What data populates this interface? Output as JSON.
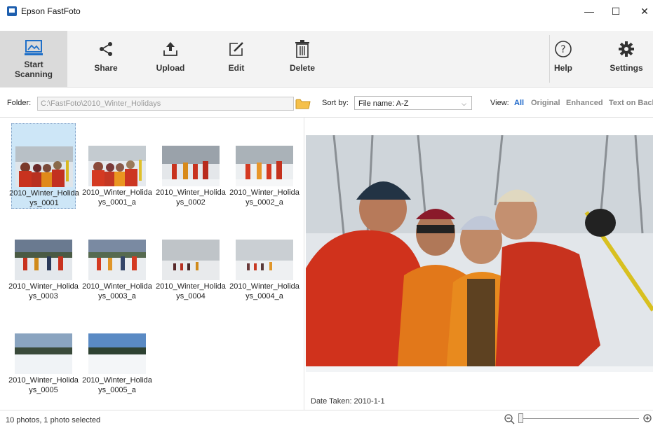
{
  "window": {
    "title": "Epson FastFoto",
    "minimize_glyph": "—",
    "maximize_glyph": "☐",
    "close_glyph": "✕"
  },
  "toolbar": {
    "start_scanning": "Start Scanning",
    "share": "Share",
    "upload": "Upload",
    "edit": "Edit",
    "delete": "Delete",
    "help": "Help",
    "settings": "Settings"
  },
  "filter": {
    "folder_label": "Folder:",
    "folder_value": "C:\\FastFoto\\2010_Winter_Holidays",
    "sort_label": "Sort by:",
    "sort_value": "File name: A-Z",
    "view_label": "View:",
    "view_options": [
      "All",
      "Original",
      "Enhanced",
      "Text on Back"
    ],
    "view_selected": "All"
  },
  "photos": [
    {
      "name": "2010_Winter_Holidays_0001",
      "selected": true
    },
    {
      "name": "2010_Winter_Holidays_0001_a",
      "selected": false
    },
    {
      "name": "2010_Winter_Holidays_0002",
      "selected": false
    },
    {
      "name": "2010_Winter_Holidays_0002_a",
      "selected": false
    },
    {
      "name": "2010_Winter_Holidays_0003",
      "selected": false
    },
    {
      "name": "2010_Winter_Holidays_0003_a",
      "selected": false
    },
    {
      "name": "2010_Winter_Holidays_0004",
      "selected": false
    },
    {
      "name": "2010_Winter_Holidays_0004_a",
      "selected": false
    },
    {
      "name": "2010_Winter_Holidays_0005",
      "selected": false
    },
    {
      "name": "2010_Winter_Holidays_0005_a",
      "selected": false
    }
  ],
  "preview": {
    "date_taken": "Date Taken: 2010-1-1"
  },
  "status": {
    "text": "10 photos, 1 photo selected",
    "zoom_level": 0
  },
  "colors": {
    "accent": "#1a66c9",
    "selected_bg": "#cde6f7",
    "toolbar_bg": "#f3f3f3",
    "active_tool_bg": "#dadada"
  }
}
